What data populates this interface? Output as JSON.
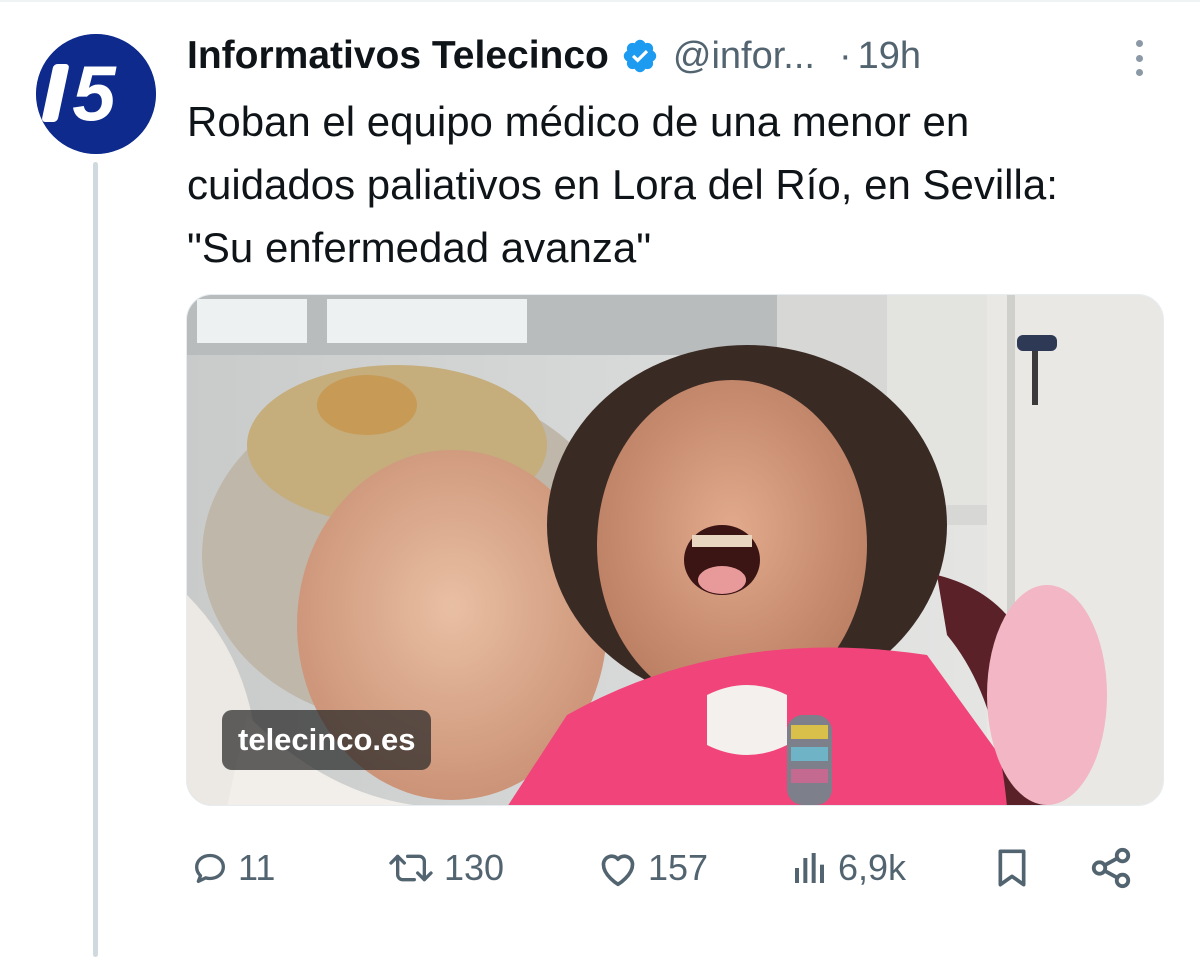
{
  "tweet": {
    "author_name": "Informativos Telecinco",
    "handle": "@infor...",
    "separator": "·",
    "time": "19h",
    "text": "Roban el equipo médico de una menor en cuidados paliativos en Lora del Río, en Sevilla: \"Su enfermedad avanza\"",
    "media_source": "telecinco.es",
    "avatar_icon": "telecinco-logo-icon",
    "verified_icon": "verified-badge-icon"
  },
  "actions": {
    "replies": "11",
    "reposts": "130",
    "likes": "157",
    "views": "6,9k"
  },
  "colors": {
    "text_primary": "#0f1419",
    "text_secondary": "#536471",
    "verified_blue": "#1d9bf0",
    "brand_navy": "#0d2a8c",
    "thread_line": "#cfd9de"
  }
}
